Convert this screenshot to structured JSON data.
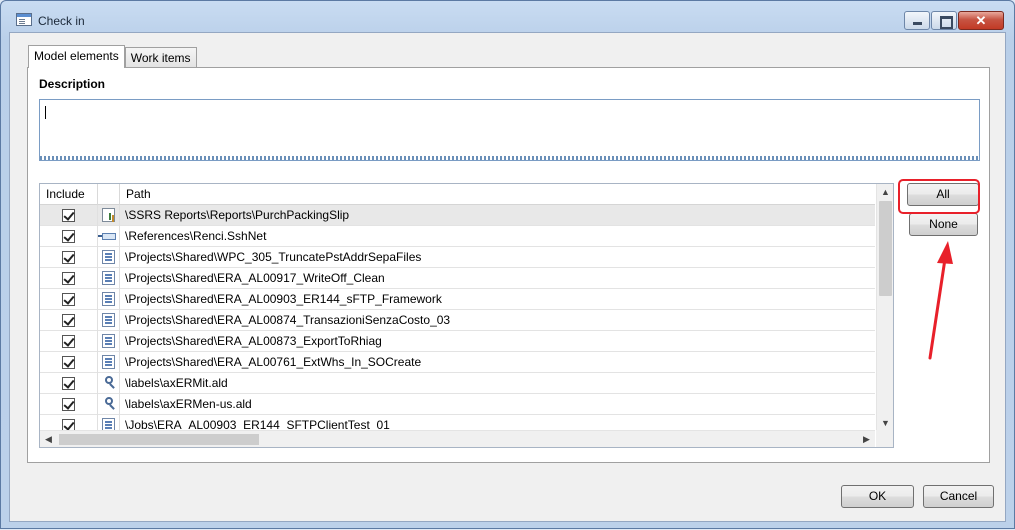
{
  "window": {
    "title": "Check in"
  },
  "tabs": [
    {
      "label": "Model elements"
    },
    {
      "label": "Work items"
    }
  ],
  "description": {
    "label": "Description",
    "value": ""
  },
  "grid": {
    "columns": [
      "Include",
      "Path"
    ],
    "rows": [
      {
        "included": true,
        "icon": "report-icon",
        "path": "\\SSRS Reports\\Reports\\PurchPackingSlip"
      },
      {
        "included": true,
        "icon": "reference-icon",
        "path": "\\References\\Renci.SshNet"
      },
      {
        "included": true,
        "icon": "project-icon",
        "path": "\\Projects\\Shared\\WPC_305_TruncatePstAddrSepaFiles"
      },
      {
        "included": true,
        "icon": "project-icon",
        "path": "\\Projects\\Shared\\ERA_AL00917_WriteOff_Clean"
      },
      {
        "included": true,
        "icon": "project-icon",
        "path": "\\Projects\\Shared\\ERA_AL00903_ER144_sFTP_Framework"
      },
      {
        "included": true,
        "icon": "project-icon",
        "path": "\\Projects\\Shared\\ERA_AL00874_TransazioniSenzaCosto_03"
      },
      {
        "included": true,
        "icon": "project-icon",
        "path": "\\Projects\\Shared\\ERA_AL00873_ExportToRhiag"
      },
      {
        "included": true,
        "icon": "project-icon",
        "path": "\\Projects\\Shared\\ERA_AL00761_ExtWhs_In_SOCreate"
      },
      {
        "included": true,
        "icon": "label-file-icon",
        "path": "\\labels\\axERMit.ald"
      },
      {
        "included": true,
        "icon": "label-file-icon",
        "path": "\\labels\\axERMen-us.ald"
      },
      {
        "included": true,
        "icon": "job-icon",
        "path": "\\Jobs\\ERA_AL00903_ER144_SFTPClientTest_01"
      }
    ]
  },
  "buttons": {
    "all": "All",
    "none": "None",
    "ok": "OK",
    "cancel": "Cancel"
  },
  "annotation": {
    "color": "#e8202a"
  }
}
